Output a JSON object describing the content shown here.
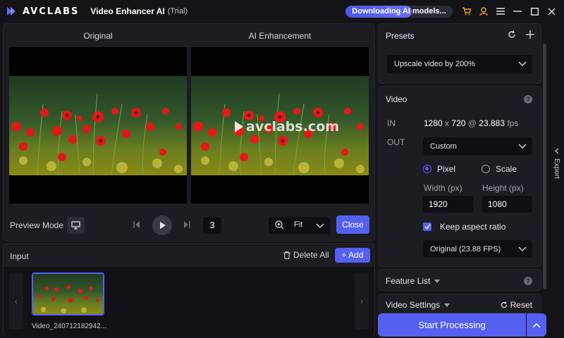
{
  "titlebar": {
    "logo_text": "AVCLABS",
    "app_name": "Video Enhancer AI",
    "edition": "(Trial)",
    "download_status": "Downloading AI models...",
    "download_progress": 0.62,
    "icons": [
      "cart-icon",
      "user-icon",
      "menu-icon",
      "minimize-icon",
      "maximize-icon",
      "close-icon"
    ]
  },
  "preview": {
    "original_label": "Original",
    "enhanced_label": "AI Enhancement",
    "watermark": "avclabs.com",
    "preview_mode_label": "Preview Mode",
    "frame_number": "3",
    "zoom": "Fit",
    "close_label": "Close"
  },
  "input": {
    "title": "Input",
    "delete_all_label": "Delete All",
    "add_label": "+ Add",
    "files": [
      {
        "name": "Video_240712182942..."
      }
    ]
  },
  "presets": {
    "title": "Presets",
    "selected": "Upscale video by 200%"
  },
  "video": {
    "title": "Video",
    "in_label": "IN",
    "out_label": "OUT",
    "in_width": "1280",
    "in_x": "x",
    "in_height": "720",
    "in_at": "@",
    "in_fps": "23.883",
    "fps_unit": "fps",
    "out_preset": "Custom",
    "pixel_label": "Pixel",
    "scale_label": "Scale",
    "width_label": "Width (px)",
    "height_label": "Height (px)",
    "width_value": "1920",
    "height_value": "1080",
    "keep_aspect_label": "Keep aspect ratio",
    "frame_rate": "Original (23.88 FPS)"
  },
  "feature_list": {
    "title": "Feature List"
  },
  "video_settings": {
    "title": "Video Settings",
    "reset_label": "Reset"
  },
  "actions": {
    "start_label": "Start Processing",
    "export_label": "Export"
  },
  "colors": {
    "accent": "#5560f0",
    "background": "#141418",
    "panel": "#1c1c22"
  }
}
